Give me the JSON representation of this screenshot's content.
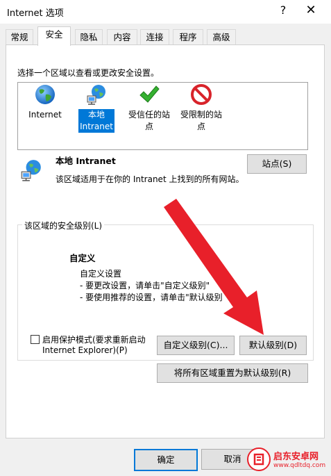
{
  "window": {
    "title": "Internet 选项",
    "help": "?",
    "close": "✕"
  },
  "tabs": [
    {
      "label": "常规"
    },
    {
      "label": "安全"
    },
    {
      "label": "隐私"
    },
    {
      "label": "内容"
    },
    {
      "label": "连接"
    },
    {
      "label": "程序"
    },
    {
      "label": "高级"
    }
  ],
  "zones": {
    "prompt": "选择一个区域以查看或更改安全设置。",
    "items": [
      {
        "line1": "Internet",
        "line2": "",
        "icon": "globe-icon"
      },
      {
        "line1": "本地",
        "line2": "Intranet",
        "icon": "intranet-network-icon",
        "selected": true
      },
      {
        "line1": "受信任的站",
        "line2": "点",
        "icon": "green-check-icon"
      },
      {
        "line1": "受限制的站",
        "line2": "点",
        "icon": "no-entry-icon"
      }
    ]
  },
  "zone_info": {
    "name": "本地 Intranet",
    "description": "该区域适用于在你的 Intranet 上找到的所有网站。",
    "sites_button": "站点(S)"
  },
  "security_level": {
    "group_label": "该区域的安全级别(L)",
    "level_name": "自定义",
    "lines": [
      "自定义设置",
      "- 要更改设置，请单击\"自定义级别\"",
      "- 要使用推荐的设置，请单击\"默认级别"
    ],
    "protected_mode_line1": "启用保护模式(要求重新启动",
    "protected_mode_line2": "Internet Explorer)(P)",
    "protected_mode_checked": false,
    "custom_level_button": "自定义级别(C)...",
    "default_level_button": "默认级别(D)",
    "reset_all_button": "将所有区域重置为默认级别(R)"
  },
  "footer": {
    "ok_button": "确定",
    "cancel_button": "取消"
  },
  "watermark": {
    "name": "启东安卓网",
    "url": "www.qdltdq.com"
  },
  "colors": {
    "selection": "#0078d7",
    "arrow": "#e8202a",
    "watermark": "#e8202a"
  }
}
